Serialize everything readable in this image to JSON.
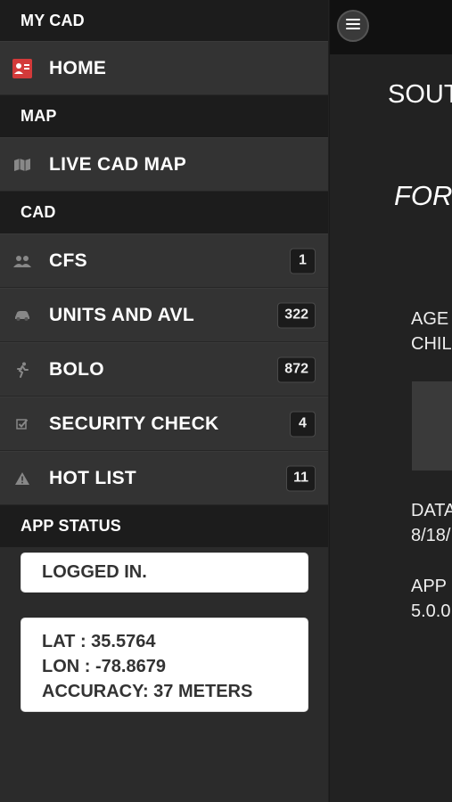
{
  "sidebar": {
    "sections": {
      "my_cad": "MY CAD",
      "map": "MAP",
      "cad": "CAD",
      "app_status": "APP STATUS"
    },
    "items": {
      "home": {
        "label": "HOME",
        "icon": "home-card-icon"
      },
      "live_map": {
        "label": "LIVE CAD MAP",
        "icon": "map-icon"
      },
      "cfs": {
        "label": "CFS",
        "icon": "people-icon",
        "badge": "1"
      },
      "units": {
        "label": "UNITS AND AVL",
        "icon": "car-icon",
        "badge": "322"
      },
      "bolo": {
        "label": "BOLO",
        "icon": "running-person-icon",
        "badge": "872"
      },
      "security": {
        "label": "SECURITY CHECK",
        "icon": "checkbox-icon",
        "badge": "4"
      },
      "hotlist": {
        "label": "HOT LIST",
        "icon": "warning-icon",
        "badge": "11"
      }
    },
    "status": {
      "login": "LOGGED IN.",
      "lat": "LAT : 35.5764",
      "lon": "LON : -78.8679",
      "accuracy": "ACCURACY: 37 METERS"
    }
  },
  "main": {
    "title": "SOUT",
    "subtitle": "FOR",
    "agency_line1": "AGE",
    "agency_line2": "CHIL",
    "data_line1": "DATA",
    "data_line2": "8/18/",
    "app_line1": "APP",
    "app_line2": "5.0.0"
  },
  "colors": {
    "accent_red": "#d33a3a"
  }
}
